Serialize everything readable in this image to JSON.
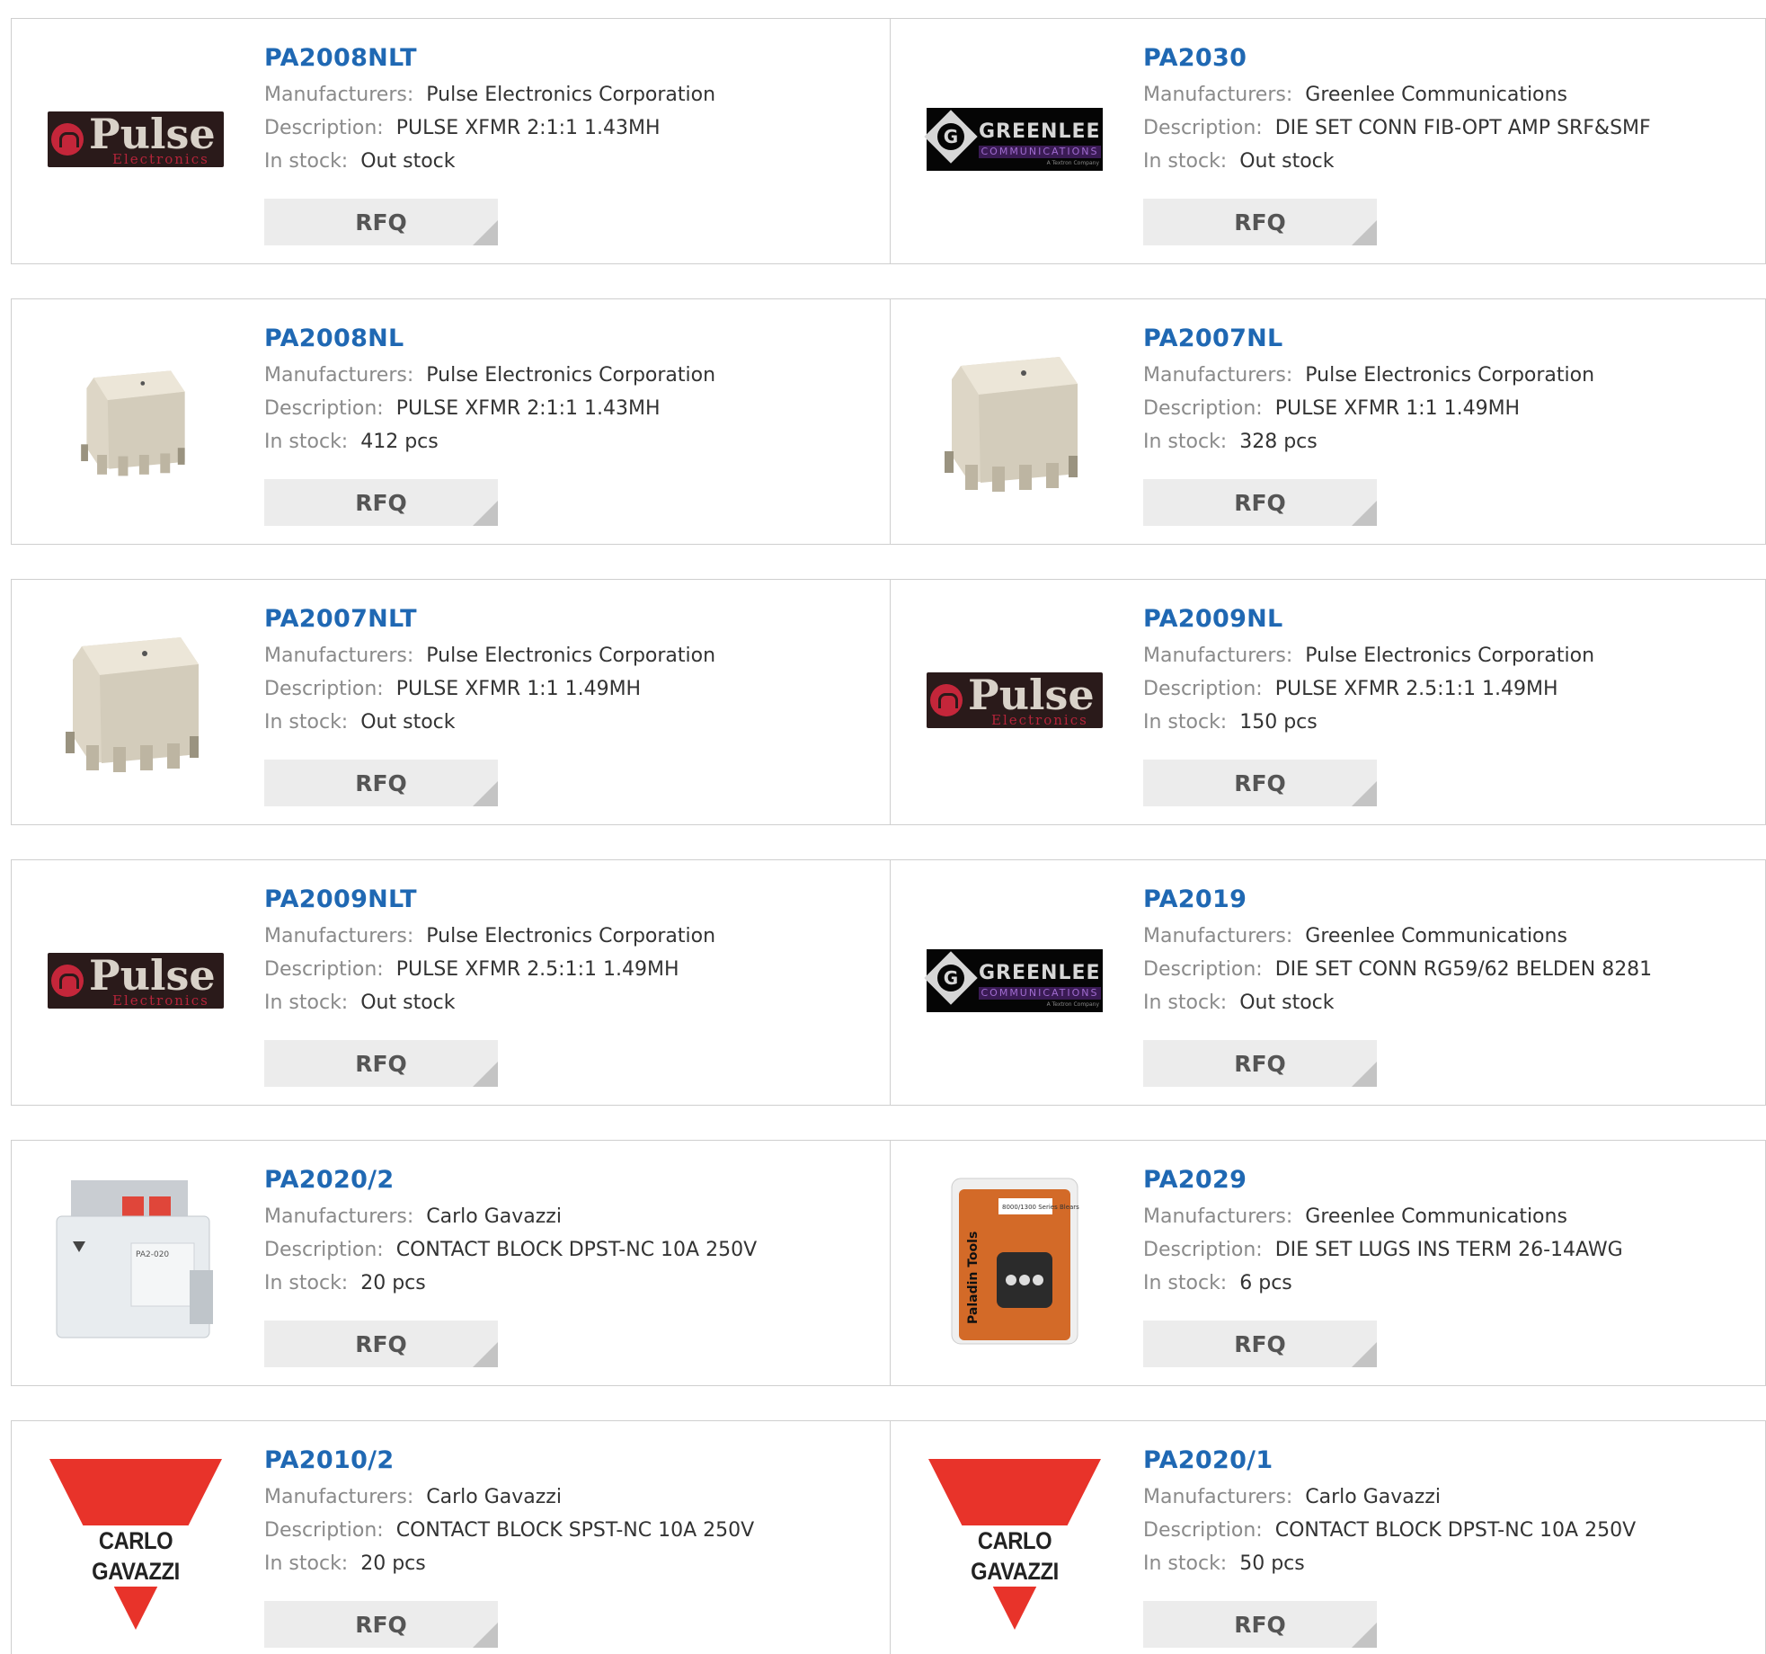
{
  "labels": {
    "manufacturers": "Manufacturers:",
    "description": "Description:",
    "in_stock": "In stock:",
    "rfq": "RFQ"
  },
  "products": [
    {
      "part": "PA2008NLT",
      "manufacturer": "Pulse Electronics Corporation",
      "description": "PULSE XFMR 2:1:1 1.43MH",
      "stock": "Out stock",
      "image": "pulse-logo"
    },
    {
      "part": "PA2030",
      "manufacturer": "Greenlee Communications",
      "description": "DIE SET CONN FIB-OPT AMP SRF&SMF",
      "stock": "Out stock",
      "image": "greenlee-logo"
    },
    {
      "part": "PA2008NL",
      "manufacturer": "Pulse Electronics Corporation",
      "description": "PULSE XFMR 2:1:1 1.43MH",
      "stock": "412 pcs",
      "image": "transformer-small"
    },
    {
      "part": "PA2007NL",
      "manufacturer": "Pulse Electronics Corporation",
      "description": "PULSE XFMR 1:1 1.49MH",
      "stock": "328 pcs",
      "image": "transformer-large"
    },
    {
      "part": "PA2007NLT",
      "manufacturer": "Pulse Electronics Corporation",
      "description": "PULSE XFMR 1:1 1.49MH",
      "stock": "Out stock",
      "image": "transformer-large"
    },
    {
      "part": "PA2009NL",
      "manufacturer": "Pulse Electronics Corporation",
      "description": "PULSE XFMR 2.5:1:1 1.49MH",
      "stock": "150 pcs",
      "image": "pulse-logo"
    },
    {
      "part": "PA2009NLT",
      "manufacturer": "Pulse Electronics Corporation",
      "description": "PULSE XFMR 2.5:1:1 1.49MH",
      "stock": "Out stock",
      "image": "pulse-logo"
    },
    {
      "part": "PA2019",
      "manufacturer": "Greenlee Communications",
      "description": "DIE SET CONN RG59/62 BELDEN 8281",
      "stock": "Out stock",
      "image": "greenlee-logo"
    },
    {
      "part": "PA2020/2",
      "manufacturer": "Carlo Gavazzi",
      "description": "CONTACT BLOCK DPST-NC 10A 250V",
      "stock": "20 pcs",
      "image": "contact-block"
    },
    {
      "part": "PA2029",
      "manufacturer": "Greenlee Communications",
      "description": "DIE SET LUGS INS TERM 26-14AWG",
      "stock": "6 pcs",
      "image": "die-set-package"
    },
    {
      "part": "PA2010/2",
      "manufacturer": "Carlo Gavazzi",
      "description": "CONTACT BLOCK SPST-NC 10A 250V",
      "stock": "20 pcs",
      "image": "carlo-gavazzi-logo"
    },
    {
      "part": "PA2020/1",
      "manufacturer": "Carlo Gavazzi",
      "description": "CONTACT BLOCK DPST-NC 10A 250V",
      "stock": "50 pcs",
      "image": "carlo-gavazzi-logo"
    }
  ],
  "logos": {
    "pulse": {
      "word": "Pulse",
      "sub": "Electronics"
    },
    "greenlee": {
      "mark": "G",
      "word": "GREENLEE",
      "sub": "COMMUNICATIONS",
      "tiny": "A Textron Company"
    },
    "carlo_gavazzi": {
      "word": "CARLO GAVAZZI"
    },
    "contact_block": {
      "label": "PA2-020"
    },
    "die_set": {
      "brand": "Paladin Tools",
      "series": "8000/1300 Series Blears"
    }
  },
  "colors": {
    "part_link": "#1f68b3",
    "label": "#8a8a8a",
    "value": "#333333",
    "rfq_bg": "#ececec",
    "border": "#cfcfcf",
    "pulse_red": "#c4263a",
    "carlo_red": "#e8332a"
  }
}
